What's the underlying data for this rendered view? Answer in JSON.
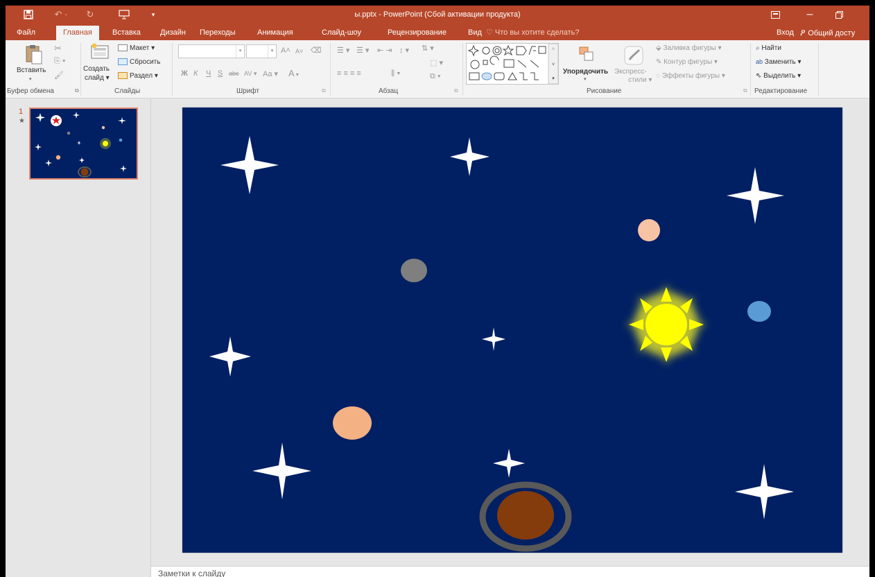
{
  "titlebar": {
    "title": "ы.pptx - PowerPoint (Сбой активации продукта)"
  },
  "tabs": [
    "Файл",
    "Главная",
    "Вставка",
    "Дизайн",
    "Переходы",
    "Анимация",
    "Слайд-шоу",
    "Рецензирование",
    "Вид"
  ],
  "active_tab": "Главная",
  "tell_me": "Что вы хотите сделать?",
  "signin": "Вход",
  "share": "Общий досту",
  "ribbon": {
    "clipboard": {
      "paste": "Вставить",
      "label": "Буфер обмена"
    },
    "slides": {
      "new_slide": "Создать",
      "new_slide2": "слайд",
      "layout": "Макет",
      "reset": "Сбросить",
      "section": "Раздел",
      "label": "Слайды"
    },
    "font": {
      "bold": "Ж",
      "italic": "К",
      "underline": "Ч",
      "strike": "S",
      "strike2": "abc",
      "spacing": "AV",
      "case": "Aa",
      "color": "A",
      "grow": "A",
      "shrink": "A",
      "label": "Шрифт"
    },
    "paragraph": {
      "label": "Абзац"
    },
    "drawing": {
      "arrange": "Упорядочить",
      "quick_styles": "Экспресс-",
      "quick_styles2": "стили",
      "fill": "Заливка фигуры",
      "outline": "Контур фигуры",
      "effects": "Эффекты фигуры",
      "label": "Рисование"
    },
    "editing": {
      "find": "Найти",
      "replace": "Заменить",
      "select": "Выделить",
      "label": "Редактирование"
    }
  },
  "thumbnail": {
    "number": "1",
    "transition_marker": "★"
  },
  "notes": {
    "label": "Заметки к слайду"
  },
  "colors": {
    "titlebar": "#b7472a",
    "slide_background": "#012063",
    "star": "#ffffff",
    "sun": "#ffff00",
    "sun_glow": "#d9d92a",
    "planet_gray": "#7f7f7f",
    "planet_peach_small": "#f7c3a5",
    "planet_peach_large": "#f4b183",
    "planet_blue": "#5b9bd5",
    "planet_brown": "#843c0c",
    "ring": "#595959"
  },
  "icons": [
    "save-icon",
    "undo-icon",
    "redo-icon",
    "slideshow-start-icon",
    "customize-icon",
    "ribbon-display-icon",
    "minimize-icon",
    "maximize-icon",
    "lightbulb-icon",
    "person-icon",
    "search-icon",
    "replace-icon",
    "select-arrow-icon"
  ]
}
